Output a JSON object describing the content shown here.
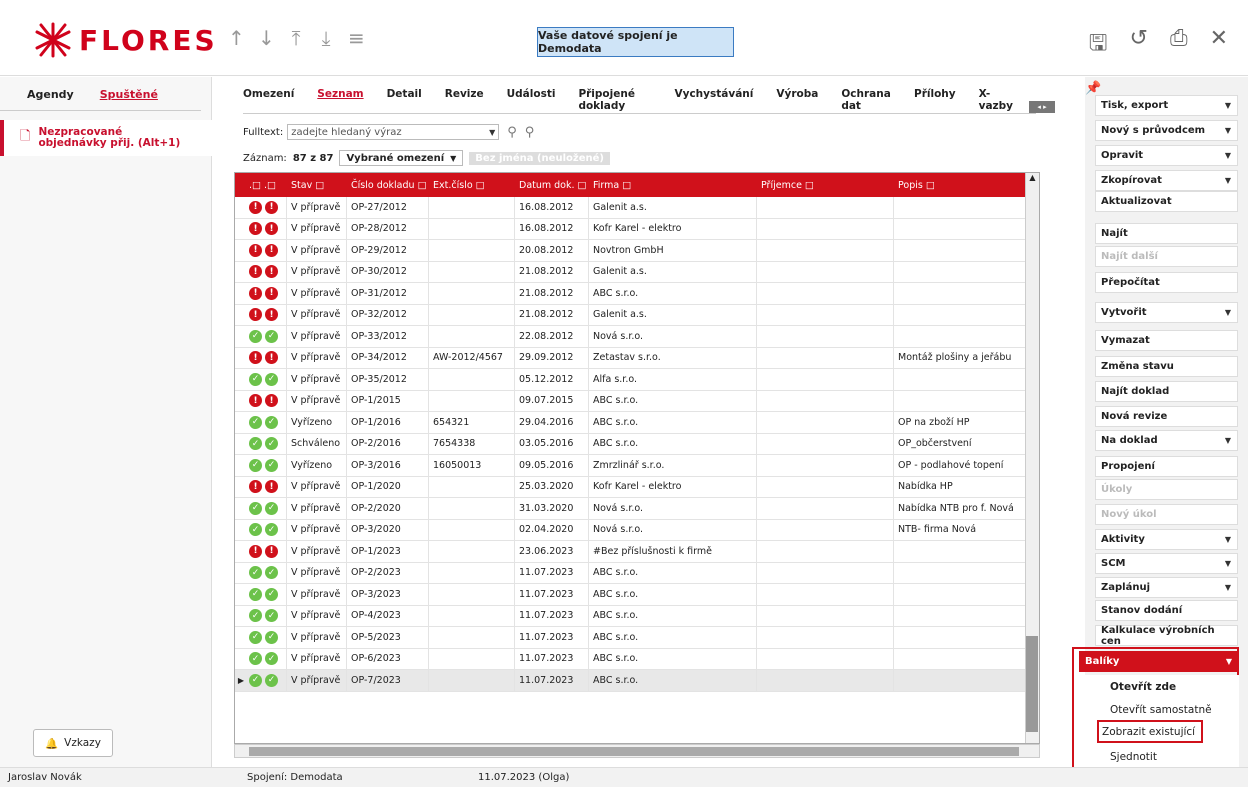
{
  "header": {
    "logo_text": "FLORES",
    "connection_banner": "Vaše datové spojení je Demodata",
    "nav_icons": [
      "arrow-up-icon",
      "arrow-down-icon",
      "arrow-to-top-icon",
      "arrow-to-bottom-icon",
      "menu-icon"
    ],
    "action_icons": [
      "save-icon",
      "undo-icon",
      "print-icon",
      "close-icon"
    ]
  },
  "left": {
    "tabs": [
      "Agendy",
      "Spuštěné"
    ],
    "active_tab": "Spuštěné",
    "item": "Nezpracované objednávky přij. (Alt+1)",
    "messages_button": "Vzkazy"
  },
  "main": {
    "tabs": [
      "Omezení",
      "Seznam",
      "Detail",
      "Revize",
      "Události",
      "Připojené doklady",
      "Vychystávání",
      "Výroba",
      "Ochrana dat",
      "Přílohy",
      "X-vazby"
    ],
    "active_tab": "Seznam",
    "fulltext_label": "Fulltext:",
    "fulltext_placeholder": "zadejte hledaný výraz",
    "records_label": "Záznam:",
    "records_value": "87 z 87",
    "filter_select": "Vybrané omezení",
    "unnamed_label": "Bez jména (neuložené)"
  },
  "table": {
    "columns": [
      ".□ .□",
      "Stav □",
      "Číslo dokladu □",
      "Ext.číslo □",
      "Datum dok. □",
      "Firma □",
      "Příjemce □",
      "Popis □"
    ],
    "rows": [
      {
        "s": "red",
        "stav": "V přípravě",
        "cislo": "OP-27/2012",
        "ext": "",
        "datum": "16.08.2012",
        "firma": "Galenit a.s.",
        "prijemce": "",
        "popis": ""
      },
      {
        "s": "red",
        "stav": "V přípravě",
        "cislo": "OP-28/2012",
        "ext": "",
        "datum": "16.08.2012",
        "firma": "Kofr Karel - elektro",
        "prijemce": "",
        "popis": ""
      },
      {
        "s": "red",
        "stav": "V přípravě",
        "cislo": "OP-29/2012",
        "ext": "",
        "datum": "20.08.2012",
        "firma": "Novtron GmbH",
        "prijemce": "",
        "popis": ""
      },
      {
        "s": "red",
        "stav": "V přípravě",
        "cislo": "OP-30/2012",
        "ext": "",
        "datum": "21.08.2012",
        "firma": "Galenit a.s.",
        "prijemce": "",
        "popis": ""
      },
      {
        "s": "red",
        "stav": "V přípravě",
        "cislo": "OP-31/2012",
        "ext": "",
        "datum": "21.08.2012",
        "firma": "ABC s.r.o.",
        "prijemce": "",
        "popis": ""
      },
      {
        "s": "red",
        "stav": "V přípravě",
        "cislo": "OP-32/2012",
        "ext": "",
        "datum": "21.08.2012",
        "firma": "Galenit a.s.",
        "prijemce": "",
        "popis": ""
      },
      {
        "s": "green",
        "stav": "V přípravě",
        "cislo": "OP-33/2012",
        "ext": "",
        "datum": "22.08.2012",
        "firma": "Nová s.r.o.",
        "prijemce": "",
        "popis": ""
      },
      {
        "s": "red",
        "stav": "V přípravě",
        "cislo": "OP-34/2012",
        "ext": "AW-2012/4567",
        "datum": "29.09.2012",
        "firma": "Zetastav s.r.o.",
        "prijemce": "",
        "popis": "Montáž plošiny a jeřábu"
      },
      {
        "s": "green",
        "stav": "V přípravě",
        "cislo": "OP-35/2012",
        "ext": "",
        "datum": "05.12.2012",
        "firma": "Alfa s.r.o.",
        "prijemce": "",
        "popis": ""
      },
      {
        "s": "red",
        "stav": "V přípravě",
        "cislo": "OP-1/2015",
        "ext": "",
        "datum": "09.07.2015",
        "firma": "ABC s.r.o.",
        "prijemce": "",
        "popis": ""
      },
      {
        "s": "green",
        "stav": "Vyřízeno",
        "cislo": "OP-1/2016",
        "ext": "654321",
        "datum": "29.04.2016",
        "firma": "ABC s.r.o.",
        "prijemce": "",
        "popis": "OP na zboží HP"
      },
      {
        "s": "green",
        "stav": "Schváleno",
        "cislo": "OP-2/2016",
        "ext": "7654338",
        "datum": "03.05.2016",
        "firma": "ABC s.r.o.",
        "prijemce": "",
        "popis": "OP_občerstvení"
      },
      {
        "s": "green",
        "stav": "Vyřízeno",
        "cislo": "OP-3/2016",
        "ext": "16050013",
        "datum": "09.05.2016",
        "firma": "Zmrzlinář s.r.o.",
        "prijemce": "",
        "popis": "OP - podlahové topení"
      },
      {
        "s": "red",
        "stav": "V přípravě",
        "cislo": "OP-1/2020",
        "ext": "",
        "datum": "25.03.2020",
        "firma": "Kofr Karel - elektro",
        "prijemce": "",
        "popis": "Nabídka HP"
      },
      {
        "s": "green",
        "stav": "V přípravě",
        "cislo": "OP-2/2020",
        "ext": "",
        "datum": "31.03.2020",
        "firma": "Nová s.r.o.",
        "prijemce": "",
        "popis": "Nabídka NTB pro f. Nová"
      },
      {
        "s": "green",
        "stav": "V přípravě",
        "cislo": "OP-3/2020",
        "ext": "",
        "datum": "02.04.2020",
        "firma": "Nová s.r.o.",
        "prijemce": "",
        "popis": "NTB- firma Nová"
      },
      {
        "s": "red",
        "stav": "V přípravě",
        "cislo": "OP-1/2023",
        "ext": "",
        "datum": "23.06.2023",
        "firma": "#Bez příslušnosti k firmě",
        "prijemce": "",
        "popis": ""
      },
      {
        "s": "green",
        "stav": "V přípravě",
        "cislo": "OP-2/2023",
        "ext": "",
        "datum": "11.07.2023",
        "firma": "ABC s.r.o.",
        "prijemce": "",
        "popis": ""
      },
      {
        "s": "green",
        "stav": "V přípravě",
        "cislo": "OP-3/2023",
        "ext": "",
        "datum": "11.07.2023",
        "firma": "ABC s.r.o.",
        "prijemce": "",
        "popis": ""
      },
      {
        "s": "green",
        "stav": "V přípravě",
        "cislo": "OP-4/2023",
        "ext": "",
        "datum": "11.07.2023",
        "firma": "ABC s.r.o.",
        "prijemce": "",
        "popis": ""
      },
      {
        "s": "green",
        "stav": "V přípravě",
        "cislo": "OP-5/2023",
        "ext": "",
        "datum": "11.07.2023",
        "firma": "ABC s.r.o.",
        "prijemce": "",
        "popis": ""
      },
      {
        "s": "green",
        "stav": "V přípravě",
        "cislo": "OP-6/2023",
        "ext": "",
        "datum": "11.07.2023",
        "firma": "ABC s.r.o.",
        "prijemce": "",
        "popis": ""
      },
      {
        "s": "green",
        "stav": "V přípravě",
        "cislo": "OP-7/2023",
        "ext": "",
        "datum": "11.07.2023",
        "firma": "ABC s.r.o.",
        "prijemce": "",
        "popis": "",
        "selected": true
      }
    ]
  },
  "right": {
    "buttons": [
      {
        "label": "Tisk, export",
        "dropdown": true,
        "disabled": false
      },
      {
        "label": "Nový s průvodcem",
        "dropdown": true,
        "disabled": false
      },
      {
        "label": "Opravit",
        "dropdown": true,
        "disabled": false
      },
      {
        "label": "Zkopírovat",
        "dropdown": true,
        "disabled": false
      },
      {
        "label": "Aktualizovat",
        "dropdown": false,
        "disabled": false
      },
      {
        "label": "Najít",
        "dropdown": false,
        "disabled": false
      },
      {
        "label": "Najít další",
        "dropdown": false,
        "disabled": true
      },
      {
        "label": "Přepočítat",
        "dropdown": false,
        "disabled": false
      },
      {
        "label": "Vytvořit",
        "dropdown": true,
        "disabled": false
      },
      {
        "label": "Vymazat",
        "dropdown": false,
        "disabled": false
      },
      {
        "label": "Změna stavu",
        "dropdown": false,
        "disabled": false
      },
      {
        "label": "Najít doklad",
        "dropdown": false,
        "disabled": false
      },
      {
        "label": "Nová revize",
        "dropdown": false,
        "disabled": false
      },
      {
        "label": "Na doklad",
        "dropdown": true,
        "disabled": false
      },
      {
        "label": "Propojení",
        "dropdown": false,
        "disabled": false
      },
      {
        "label": "Úkoly",
        "dropdown": false,
        "disabled": true
      },
      {
        "label": "Nový úkol",
        "dropdown": false,
        "disabled": true
      },
      {
        "label": "Aktivity",
        "dropdown": true,
        "disabled": false
      },
      {
        "label": "SCM",
        "dropdown": true,
        "disabled": false
      },
      {
        "label": "Zaplánuj",
        "dropdown": true,
        "disabled": false
      },
      {
        "label": "Stanov dodání",
        "dropdown": false,
        "disabled": false
      },
      {
        "label": "Kalkulace výrobních cen",
        "dropdown": false,
        "disabled": false
      }
    ],
    "baliky_label": "Balíky",
    "menu": [
      "Otevřít zde",
      "Otevřít samostatně",
      "Zobrazit existující",
      "Sjednotit"
    ],
    "accent_color": "#d0111b"
  },
  "status": {
    "user": "Jaroslav Novák",
    "connection": "Spojení: Demodata",
    "date": "11.07.2023 (Olga)"
  }
}
